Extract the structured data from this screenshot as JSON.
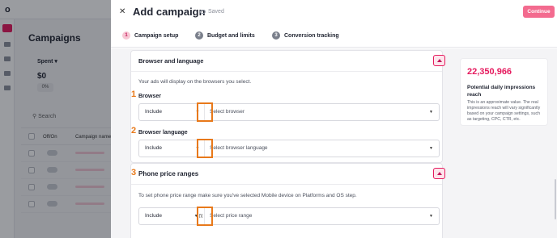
{
  "background": {
    "logo": "o",
    "page_title": "Campaigns",
    "spent_label": "Spent ▾",
    "spent_value": "$0",
    "spent_pct": "0%",
    "search_label": "Search",
    "columns": [
      "Off/On",
      "Campaign name"
    ],
    "rows": 4
  },
  "drawer": {
    "title": "Add campaign",
    "saved_label": "Saved",
    "continue_label": "Continue",
    "close_glyph": "✕",
    "steps": [
      {
        "num": "1",
        "label": "Campaign setup",
        "active": true
      },
      {
        "num": "2",
        "label": "Budget and limits",
        "active": false
      },
      {
        "num": "3",
        "label": "Conversion tracking",
        "active": false
      }
    ]
  },
  "browser_section": {
    "title": "Browser and language",
    "description": "Your ads will display on the browsers you select.",
    "fields": [
      {
        "marker": "1",
        "label": "Browser",
        "mode": "Include",
        "caret": "▼",
        "placeholder": "Select browser"
      },
      {
        "marker": "2",
        "label": "Browser language",
        "mode": "Include",
        "caret": "▼",
        "placeholder": "Select browser language"
      }
    ]
  },
  "phone_section": {
    "marker": "3",
    "title": "Phone price ranges",
    "description": "To set phone price range make sure you've selected Mobile device on Platforms and OS step.",
    "field": {
      "mode": "Include",
      "caret": "▼ [\\]",
      "placeholder": "Select price range"
    }
  },
  "impressions": {
    "value": "22,350,966",
    "title": "Potential daily impressions reach",
    "note": "This is an approximate value. The real impressions reach will vary significantly based on your campaign settings, such as targeting, CPC, CTR, etc."
  },
  "colors": {
    "accent": "#e5195d",
    "highlight": "#e8791a",
    "continue_bg": "#f36b8f"
  }
}
